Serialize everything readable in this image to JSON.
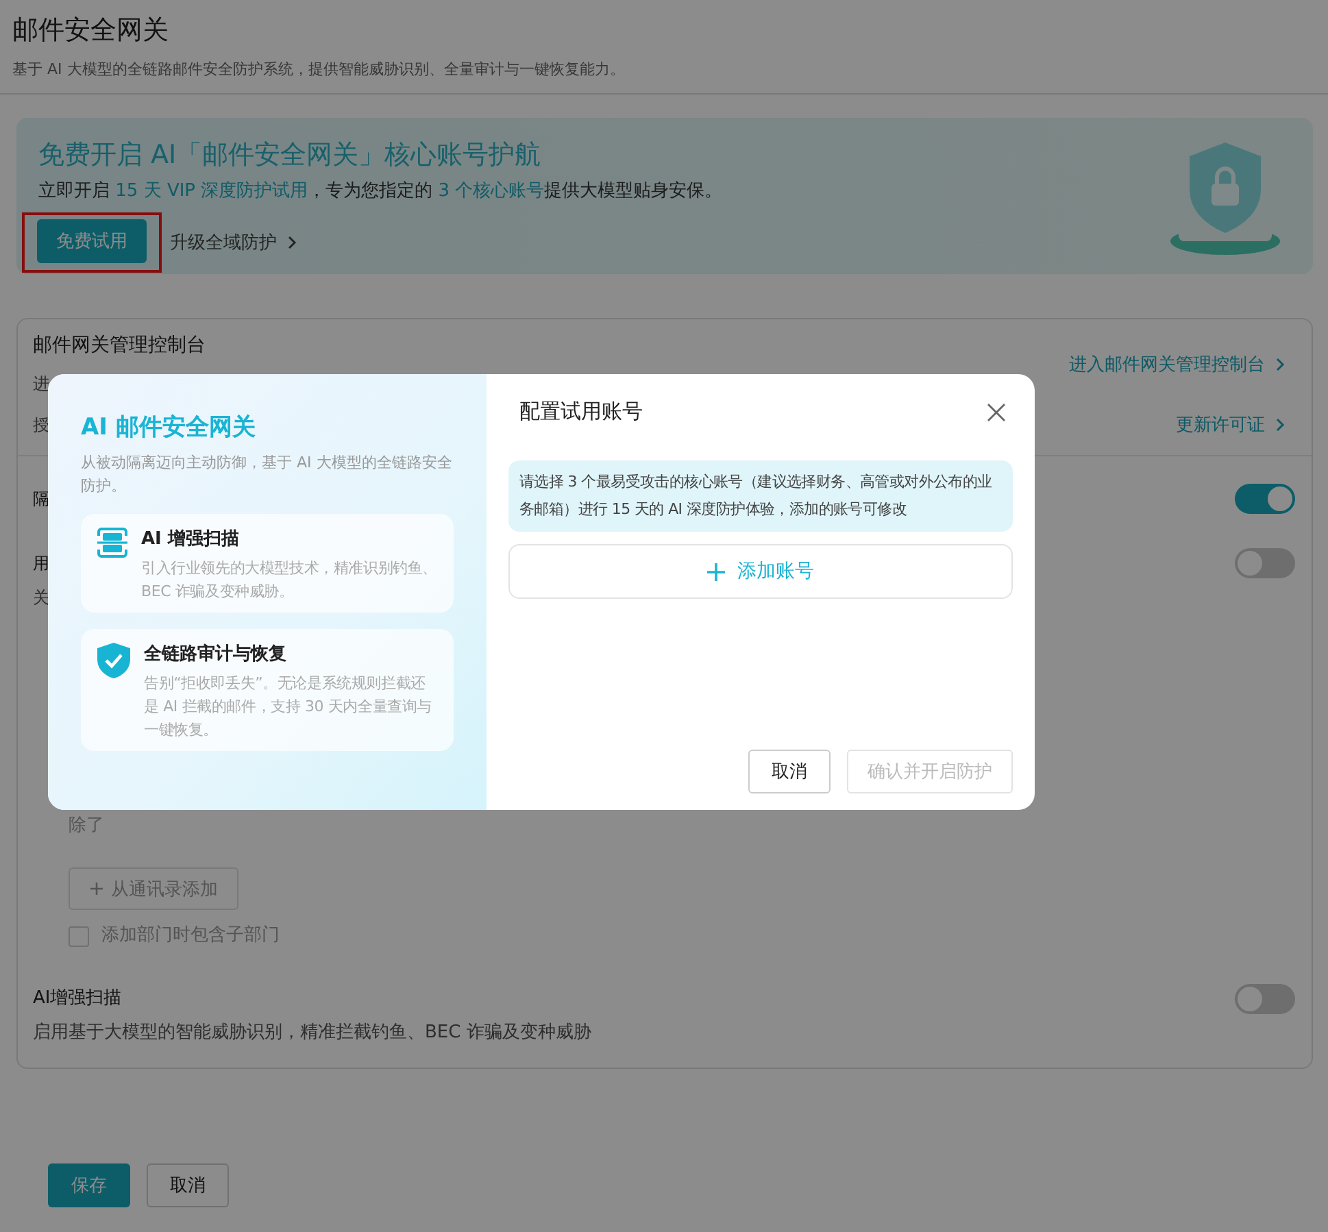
{
  "page": {
    "title": "邮件安全网关",
    "subtitle": "基于 AI 大模型的全链路邮件安全防护系统，提供智能威胁识别、全量审计与一键恢复能力。"
  },
  "banner": {
    "title": "免费开启 AI「邮件安全网关」核心账号护航",
    "subtitle": [
      {
        "text": "立即开启 ",
        "highlight": false
      },
      {
        "text": "15 天 VIP 深度防护试用",
        "highlight": true
      },
      {
        "text": "，专为您指定的 ",
        "highlight": false
      },
      {
        "text": "3 个核心账号",
        "highlight": true
      },
      {
        "text": "提供大模型贴身安保。",
        "highlight": false
      }
    ],
    "trial_button": {
      "label": "免费试用",
      "highlighted": true
    },
    "upgrade_link": "升级全域防护"
  },
  "console": {
    "title": "邮件网关管理控制台",
    "fragment": "进",
    "link": "进入邮件网关管理控制台"
  },
  "license": {
    "fragment": "授",
    "link": "更新许可证"
  },
  "toggles": [
    {
      "label": "隔",
      "on": true
    },
    {
      "label": "用",
      "description": "关",
      "on": false
    }
  ],
  "exclusions": {
    "text": "除了",
    "add_button": "从通讯录添加",
    "include_sub": {
      "label": "添加部门时包含子部门",
      "checked": false
    }
  },
  "ai_scan": {
    "label": "AI增强扫描",
    "description": "启用基于大模型的智能威胁识别，精准拦截钓鱼、BEC 诈骗及变种威胁",
    "on": false
  },
  "footer": {
    "save": "保存",
    "cancel": "取消"
  },
  "modal": {
    "left": {
      "title": "AI 邮件安全网关",
      "subtitle": "从被动隔离迈向主动防御，基于 AI 大模型的全链路安全防护。",
      "features": [
        {
          "kind": "scan",
          "title": "AI 增强扫描",
          "desc": "引入行业领先的大模型技术，精准识别钓鱼、BEC 诈骗及变种威胁。"
        },
        {
          "kind": "shield",
          "title": "全链路审计与恢复",
          "desc": "告别“拒收即丢失”。无论是系统规则拦截还是 AI 拦截的邮件，支持 30 天内全量查询与一键恢复。"
        }
      ]
    },
    "right": {
      "title": "配置试用账号",
      "notice": "请选择 3 个最易受攻击的核心账号（建议选择财务、高管或对外公布的业务邮箱）进行 15 天的 AI 深度防护体验，添加的账号可修改",
      "add_button": "添加账号",
      "cancel": "取消",
      "confirm": {
        "label": "确认并开启防护",
        "disabled": true
      }
    }
  }
}
